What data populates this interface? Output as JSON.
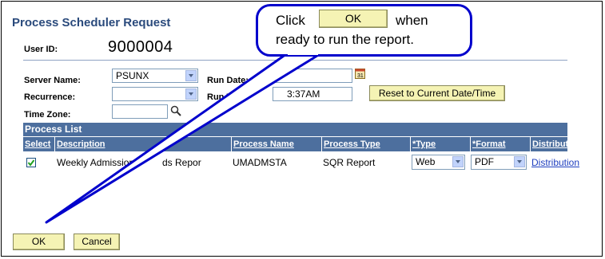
{
  "page": {
    "title": "Process Scheduler Request",
    "user_id_label": "User ID:",
    "user_id_value": "9000004"
  },
  "fields": {
    "server_name_label": "Server Name:",
    "server_name_value": "PSUNX",
    "recurrence_label": "Recurrence:",
    "recurrence_value": "",
    "time_zone_label": "Time Zone:",
    "time_zone_value": "",
    "run_date_label": "Run Date:",
    "run_time_label": "Run Tim",
    "run_time_value": "3:37AM",
    "reset_button": "Reset to Current Date/Time"
  },
  "process_list": {
    "header": "Process List",
    "columns": [
      "Select",
      "Description",
      "Process Name",
      "Process Type",
      "*Type",
      "*Format",
      "Distribution"
    ],
    "rows": [
      {
        "selected": true,
        "description": "Weekly Admissions",
        "description_tail": "ds Repor",
        "process_name": "UMADMSTA",
        "process_type": "SQR Report",
        "type": "Web",
        "format": "PDF",
        "distribution": "Distribution"
      }
    ]
  },
  "buttons": {
    "ok": "OK",
    "cancel": "Cancel"
  },
  "callout": {
    "line1_before": "Click",
    "button_label": "OK",
    "line1_after": "when",
    "line2": "ready to run the report."
  },
  "colors": {
    "grid_header": "#4d6f9e",
    "button_bg": "#f5f3b4",
    "callout_border": "#0000cc",
    "title": "#2a4a7c"
  },
  "icons": {
    "calendar": "calendar-icon",
    "lookup": "magnifier-icon",
    "checkmark": "checkmark-icon"
  }
}
